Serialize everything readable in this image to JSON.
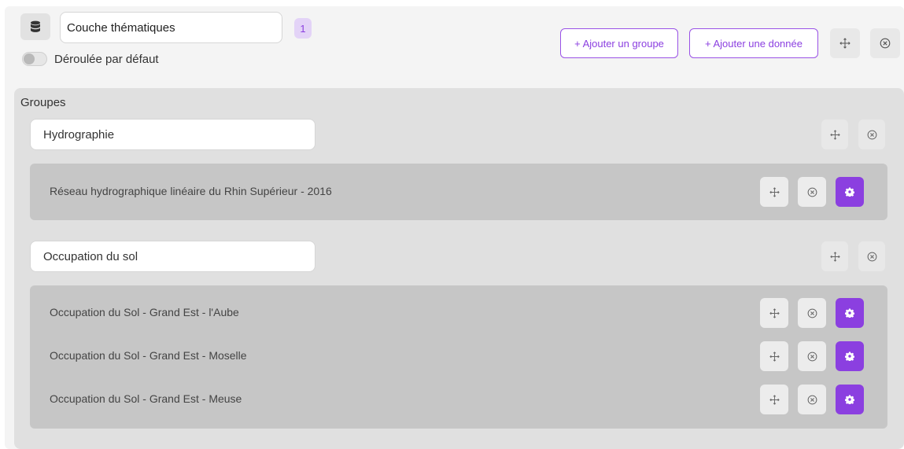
{
  "layer": {
    "title_value": "Couche thématiques",
    "count": "1",
    "toggle_label": "Déroulée par défaut",
    "toggle_on": false,
    "add_group_label": "+ Ajouter un groupe",
    "add_data_label": "+ Ajouter une donnée"
  },
  "groups_label": "Groupes",
  "groups": [
    {
      "name": "Hydrographie",
      "items": [
        "Réseau hydrographique linéaire du Rhin Supérieur - 2016"
      ]
    },
    {
      "name": "Occupation du sol",
      "items": [
        "Occupation du Sol - Grand Est - l'Aube",
        "Occupation du Sol - Grand Est - Moselle",
        "Occupation du Sol - Grand Est - Meuse"
      ]
    }
  ],
  "colors": {
    "accent": "#8b3fe0",
    "accent_light": "#e3d3f7",
    "panel_bg": "#f4f4f4",
    "groups_bg": "#e0e0e0",
    "items_bg": "#c6c6c6"
  },
  "icons": {
    "database": "database-icon",
    "move": "move-icon",
    "close": "close-circle-icon",
    "settings": "gear-icon"
  }
}
